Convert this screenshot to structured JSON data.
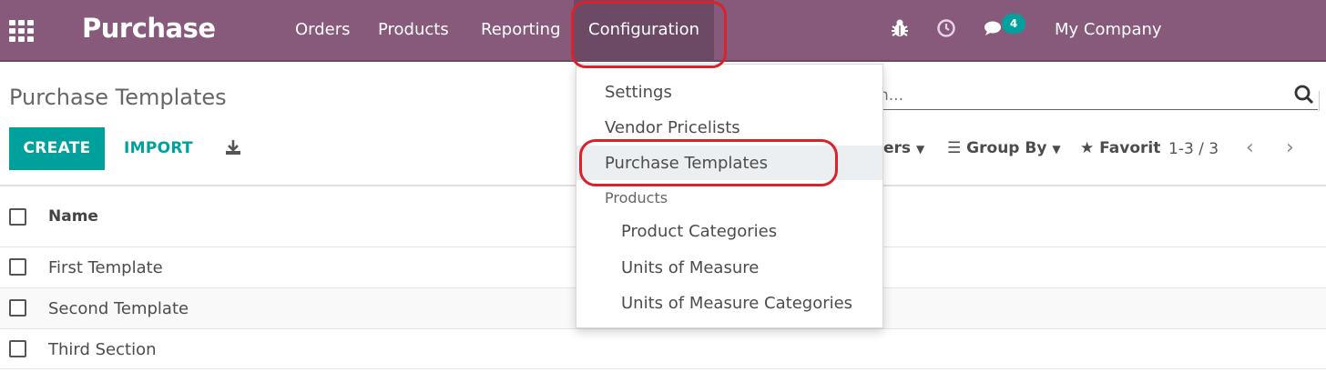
{
  "navbar": {
    "brand": "Purchase",
    "menu": [
      {
        "label": "Orders"
      },
      {
        "label": "Products"
      },
      {
        "label": "Reporting"
      },
      {
        "label": "Configuration"
      }
    ],
    "message_count": "4",
    "company": "My Company"
  },
  "control_panel": {
    "title": "Purchase Templates",
    "create_label": "CREATE",
    "import_label": "IMPORT",
    "search_placeholder": "h...",
    "filters_label": "ers",
    "groupby_label": "Group By",
    "favorites_label": "Favorit",
    "pager": "1-3 / 3"
  },
  "table": {
    "header_name": "Name",
    "rows": [
      {
        "name": "First Template"
      },
      {
        "name": "Second Template"
      },
      {
        "name": "Third Section"
      }
    ]
  },
  "dropdown": {
    "items": [
      {
        "label": "Settings"
      },
      {
        "label": "Vendor Pricelists"
      },
      {
        "label": "Purchase Templates"
      }
    ],
    "section_header": "Products",
    "sub_items": [
      {
        "label": "Product Categories"
      },
      {
        "label": "Units of Measure"
      },
      {
        "label": "Units of Measure Categories"
      }
    ]
  },
  "colors": {
    "navbar": "#875a7b",
    "accent": "#00a09d",
    "annotation": "#d8232a"
  }
}
